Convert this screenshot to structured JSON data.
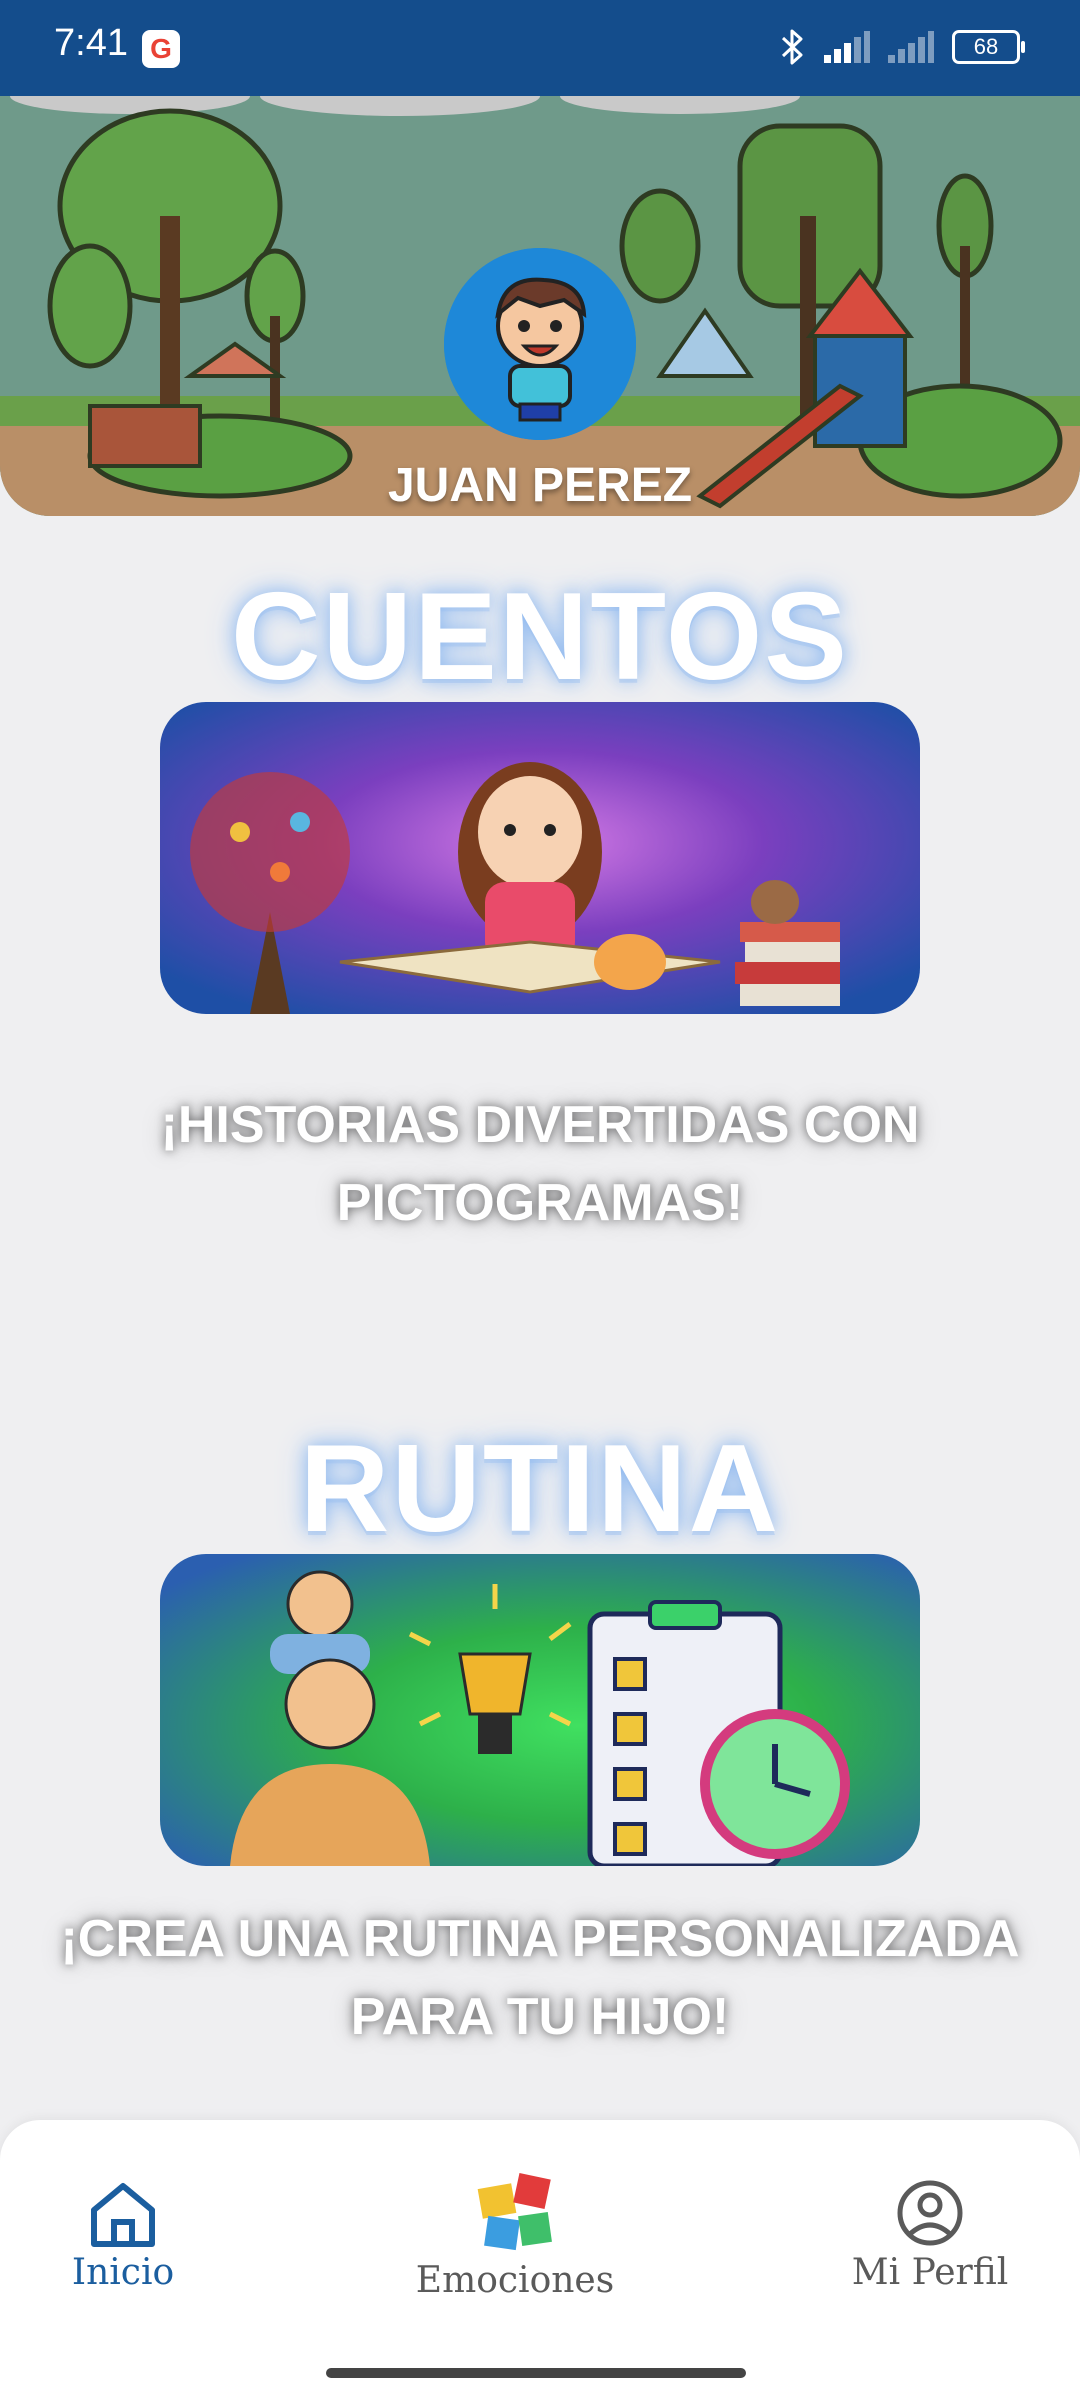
{
  "status_bar": {
    "time": "7:41",
    "g_badge": "G",
    "battery": "68",
    "icons": [
      "bluetooth-icon",
      "signal-icon",
      "signal-icon"
    ]
  },
  "header": {
    "user_name": "JUAN PEREZ"
  },
  "cards": [
    {
      "title": "CUENTOS",
      "caption_line1": "¡HISTORIAS DIVERTIDAS CON",
      "caption_line2": "PICTOGRAMAS!"
    },
    {
      "title": "RUTINA",
      "caption_line1": "¡CREA UNA RUTINA PERSONALIZADA",
      "caption_line2": "PARA TU HIJO!"
    }
  ],
  "bottom_nav": {
    "items": [
      {
        "label": "Inicio",
        "icon": "home-icon",
        "active": true
      },
      {
        "label": "Emociones",
        "icon": "puzzle-icon",
        "active": false
      },
      {
        "label": "Mi Perfil",
        "icon": "profile-icon",
        "active": false
      }
    ],
    "active_color": "#1b5e9f",
    "inactive_color": "#5a5a5a"
  }
}
